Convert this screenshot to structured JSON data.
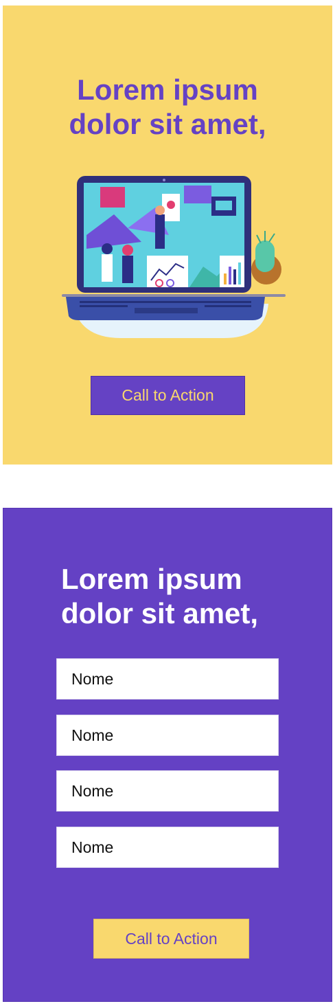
{
  "hero": {
    "headline_line1": "Lorem ipsum",
    "headline_line2": "dolor sit amet,",
    "cta_label": "Call to Action"
  },
  "form_section": {
    "headline_line1": "Lorem ipsum",
    "headline_line2": "dolor sit amet,",
    "fields": [
      {
        "placeholder": "Nome"
      },
      {
        "placeholder": "Nome"
      },
      {
        "placeholder": "Nome"
      },
      {
        "placeholder": "Nome"
      }
    ],
    "cta_label": "Call to Action"
  },
  "colors": {
    "yellow": "#f9d86e",
    "purple": "#6441c4",
    "white": "#ffffff"
  },
  "icons": {
    "illustration": "laptop-business-team-illustration"
  }
}
